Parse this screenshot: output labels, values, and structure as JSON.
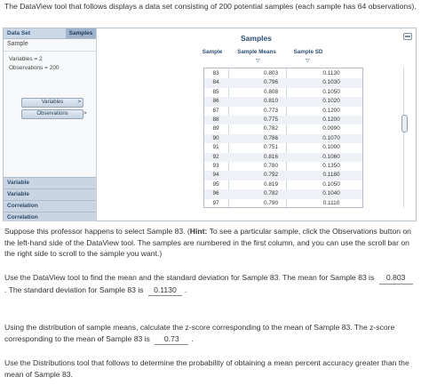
{
  "intro": "The DataView tool that follows displays a data set consisting of 200 potential samples (each sample has 64 observations).",
  "left_panel": {
    "header_left": "Data Set",
    "header_right": "Samples",
    "sample_label": "Sample",
    "variables_text": "Variables = 2",
    "observations_text": "Observations = 200",
    "variables_button": "Variables",
    "observations_button": "Observations",
    "arrow": ">",
    "bars": [
      "Variable",
      "Variable",
      "Correlation",
      "Correlation"
    ]
  },
  "samples_panel": {
    "title": "Samples",
    "col_sample": "Sample",
    "col_means": "Sample Means",
    "col_sd": "Sample SD",
    "sort_icon": "triangle-down-icon",
    "rows": [
      {
        "sample": "83",
        "mean": "0.803",
        "sd": "0.1130"
      },
      {
        "sample": "84",
        "mean": "0.796",
        "sd": "0.1030"
      },
      {
        "sample": "85",
        "mean": "0.808",
        "sd": "0.1050"
      },
      {
        "sample": "86",
        "mean": "0.810",
        "sd": "0.1020"
      },
      {
        "sample": "87",
        "mean": "0.773",
        "sd": "0.1200"
      },
      {
        "sample": "88",
        "mean": "0.775",
        "sd": "0.1200"
      },
      {
        "sample": "89",
        "mean": "0.782",
        "sd": "0.0990"
      },
      {
        "sample": "90",
        "mean": "0.786",
        "sd": "0.1070"
      },
      {
        "sample": "91",
        "mean": "0.751",
        "sd": "0.1000"
      },
      {
        "sample": "92",
        "mean": "0.816",
        "sd": "0.1060"
      },
      {
        "sample": "93",
        "mean": "0.780",
        "sd": "0.1350"
      },
      {
        "sample": "94",
        "mean": "0.792",
        "sd": "0.1180"
      },
      {
        "sample": "95",
        "mean": "0.819",
        "sd": "0.1050"
      },
      {
        "sample": "96",
        "mean": "0.782",
        "sd": "0.1040"
      },
      {
        "sample": "97",
        "mean": "0.790",
        "sd": "0.1110"
      }
    ]
  },
  "para1_a": "Suppose this professor happens to select Sample 83. (",
  "para1_hint": "Hint:",
  "para1_b": " To see a particular sample, click the Observations button on the left-hand side of the DataView tool. The samples are numbered in the first column, and you can use the scroll bar on the right side to scroll to the sample you want.)",
  "para2_a": "Use the DataView tool to find the mean and the standard deviation for Sample 83. The mean for Sample 83 is",
  "para2_ans1": "0.803",
  "para2_b": ". The standard deviation for Sample 83 is",
  "para2_ans2": "0.1130",
  "para2_c": ".",
  "para3_a": "Using the distribution of sample means, calculate the z-score corresponding to the mean of Sample 83. The z-score corresponding to the mean of Sample 83 is",
  "para3_ans": "0.73",
  "para3_b": ".",
  "para4": "Use the Distributions tool that follows to determine the probability of obtaining a mean percent accuracy greater than the mean of Sample 83."
}
